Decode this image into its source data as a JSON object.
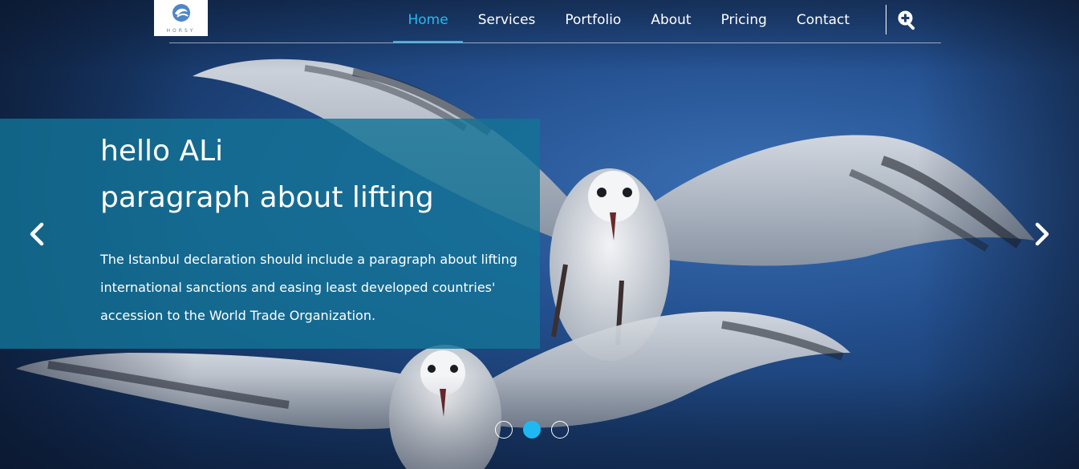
{
  "brand": {
    "logo_text": "HORSY",
    "accent_color": "#27b8f0"
  },
  "nav": {
    "items": [
      {
        "label": "Home",
        "active": true
      },
      {
        "label": "Services"
      },
      {
        "label": "Portfolio"
      },
      {
        "label": "About"
      },
      {
        "label": "Pricing"
      },
      {
        "label": "Contact"
      }
    ],
    "search_icon": "search-plus-icon"
  },
  "slide": {
    "title_line1": "hello ALi",
    "title_line2": "paragraph about lifting",
    "body": "The Istanbul declaration should include a paragraph about lifting international sanctions and easing least developed countries' accession to the World Trade Organization.",
    "prev_icon": "chevron-left-icon",
    "next_icon": "chevron-right-icon"
  },
  "carousel": {
    "slide_count": 3,
    "active_index": 2
  }
}
